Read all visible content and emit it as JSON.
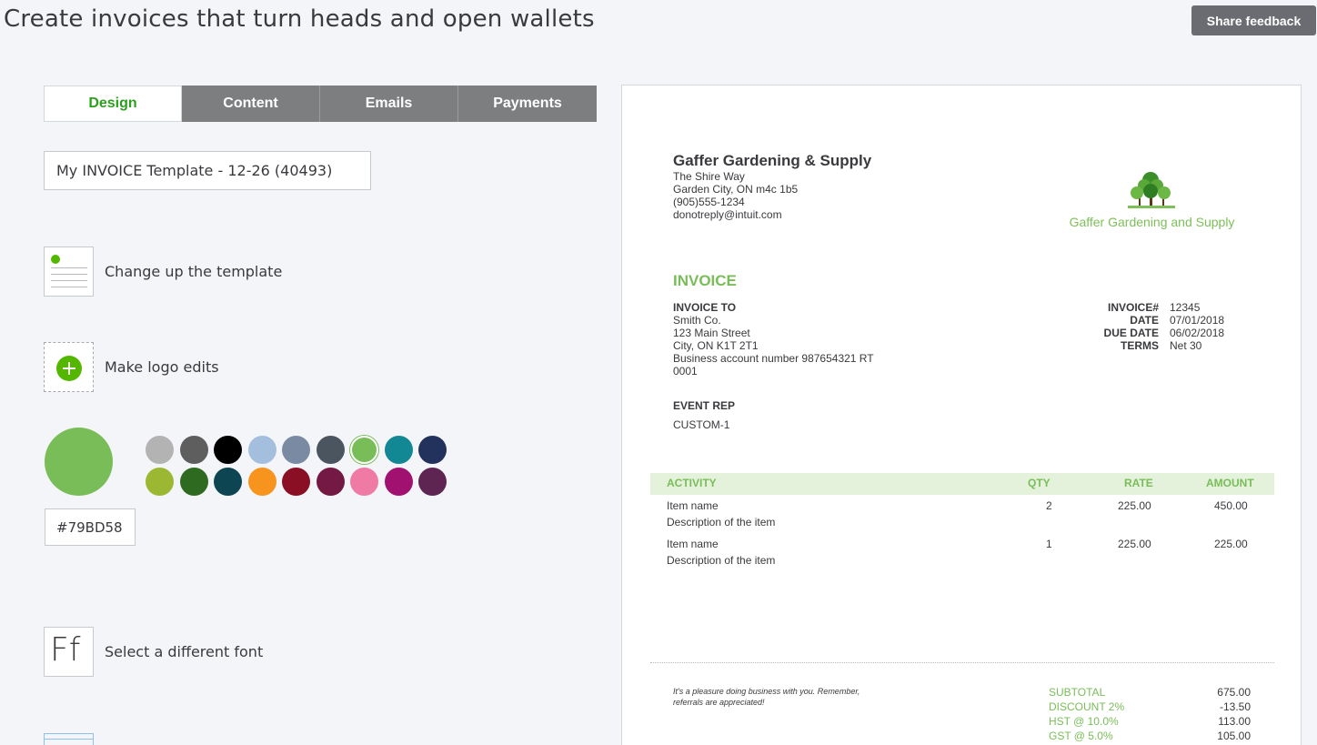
{
  "header": {
    "title": "Create invoices that turn heads and open wallets",
    "feedback_label": "Share feedback"
  },
  "tabs": [
    {
      "label": "Design",
      "active": true
    },
    {
      "label": "Content",
      "active": false
    },
    {
      "label": "Emails",
      "active": false
    },
    {
      "label": "Payments",
      "active": false
    }
  ],
  "template_name": "My INVOICE Template - 12-26 (40493)",
  "options": {
    "template": "Change up the template",
    "logo": "Make logo edits",
    "font": "Select a different font"
  },
  "font_icon_glyph": "Ff",
  "colors": {
    "selected": "#79BD58",
    "swatches_row1": [
      "#b3b3b3",
      "#5e5e5e",
      "#000000",
      "#a4bfdd",
      "#7a8aa3",
      "#4a5560",
      "#79bd58",
      "#118894",
      "#23315d"
    ],
    "swatches_row2": [
      "#9cb832",
      "#2e6a20",
      "#0d4552",
      "#f7941d",
      "#8a0f24",
      "#731943",
      "#ef7aa3",
      "#a11270",
      "#5e2552"
    ]
  },
  "invoice": {
    "company": {
      "name": "Gaffer Gardening & Supply",
      "address1": "The Shire Way",
      "address2": "Garden City, ON m4c 1b5",
      "phone": "(905)555-1234",
      "email": "donotreply@intuit.com",
      "logo_text": "Gaffer Gardening and Supply"
    },
    "title": "INVOICE",
    "bill_to": {
      "heading": "INVOICE TO",
      "lines": [
        "Smith Co.",
        "123 Main Street",
        "City, ON K1T 2T1",
        "Business account number 987654321 RT",
        "0001"
      ]
    },
    "meta": [
      {
        "label": "INVOICE#",
        "value": "12345"
      },
      {
        "label": "DATE",
        "value": "07/01/2018"
      },
      {
        "label": "DUE DATE",
        "value": "06/02/2018"
      },
      {
        "label": "TERMS",
        "value": "Net 30"
      }
    ],
    "event_rep": {
      "heading": "EVENT REP",
      "value": "CUSTOM-1"
    },
    "columns": {
      "activity": "ACTIVITY",
      "qty": "QTY",
      "rate": "RATE",
      "amount": "AMOUNT"
    },
    "items": [
      {
        "name": "Item name",
        "description": "Description of the item",
        "qty": "2",
        "rate": "225.00",
        "amount": "450.00"
      },
      {
        "name": "Item name",
        "description": "Description of the item",
        "qty": "1",
        "rate": "225.00",
        "amount": "225.00"
      }
    ],
    "note": "It's a pleasure doing business with you. Remember, referrals are appreciated!",
    "totals": [
      {
        "label": "SUBTOTAL",
        "value": "675.00"
      },
      {
        "label": "DISCOUNT 2%",
        "value": "-13.50"
      },
      {
        "label": "HST @ 10.0%",
        "value": "113.00"
      },
      {
        "label": "GST @ 5.0%",
        "value": "105.00"
      }
    ]
  }
}
